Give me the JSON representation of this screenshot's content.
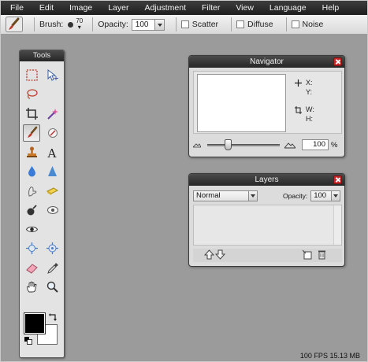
{
  "menu": {
    "items": [
      "File",
      "Edit",
      "Image",
      "Layer",
      "Adjustment",
      "Filter",
      "View",
      "Language",
      "Help"
    ]
  },
  "options": {
    "brush_label": "Brush:",
    "brush_size": "70",
    "opacity_label": "Opacity:",
    "opacity_value": "100",
    "scatter_label": "Scatter",
    "diffuse_label": "Diffuse",
    "noise_label": "Noise"
  },
  "tools": {
    "title": "Tools",
    "items": [
      "marquee-select-icon",
      "move-icon",
      "lasso-icon",
      "",
      "crop-icon",
      "magic-wand-icon",
      "brush-icon",
      "eraser-icon",
      "stamp-icon",
      "type-icon",
      "blur-drop-icon",
      "sharpen-icon",
      "smudge-icon",
      "sponge-icon",
      "burn-icon",
      "dodge-icon",
      "red-eye-icon",
      "",
      "spot-heal-icon",
      "bloat-icon",
      "rubber-eraser-icon",
      "color-picker-icon",
      "hand-icon",
      "zoom-icon"
    ],
    "foreground_color": "#000000",
    "background_color": "#ffffff"
  },
  "navigator": {
    "title": "Navigator",
    "x_label": "X:",
    "y_label": "Y:",
    "w_label": "W:",
    "h_label": "H:",
    "zoom_value": "100",
    "zoom_unit": "%",
    "zoom_slider_level": 0.26
  },
  "layers": {
    "title": "Layers",
    "blend_mode": "Normal",
    "opacity_label": "Opacity:",
    "opacity_value": "100"
  },
  "status": {
    "fps": "100 FPS",
    "memory": "15.13 MB"
  },
  "colors": {
    "menubar": "#2a2a2a",
    "close_button": "#c8272a",
    "accent_blue": "#3a7bd5"
  }
}
